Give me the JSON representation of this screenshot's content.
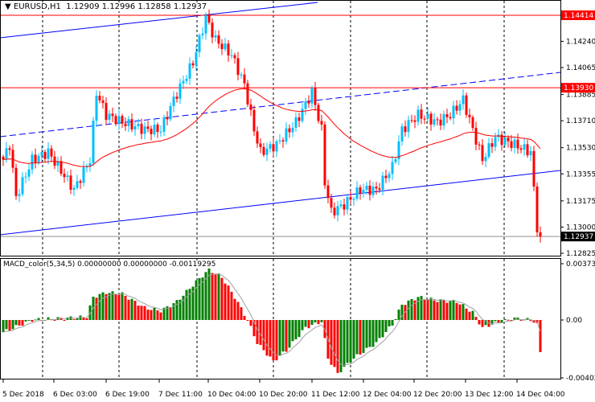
{
  "header": {
    "symbol_label": "EURUSD,H1",
    "ohlc": "1.12909 1.12996 1.12858 1.12937"
  },
  "macd_label": "MACD_color(5,34,5) 0.00000000 0.00000000 -0.00119295",
  "colors": {
    "bull": "#00BFFF",
    "bear": "#FF0000",
    "channel": "#0000FF",
    "level": "#FF0000",
    "ma": "#FF0000",
    "macd_up": "#008000",
    "macd_down": "#FF0000",
    "signal": "#A0A0A0"
  },
  "chart_data": [
    {
      "type": "candlestick",
      "title": "EURUSD,H1",
      "ylim": [
        1.12825,
        1.14414
      ],
      "price_ticks": [
        "1.14240",
        "1.14065",
        "1.13885",
        "1.13710",
        "1.13530",
        "1.13355",
        "1.13175",
        "1.13000",
        "1.12825"
      ],
      "tick_values": [
        1.1424,
        1.14065,
        1.13885,
        1.1371,
        1.1353,
        1.13355,
        1.13175,
        1.13,
        1.12825
      ],
      "levels": [
        {
          "label": "1.14414",
          "value": 1.14414
        },
        {
          "label": "1.13930",
          "value": 1.1393
        }
      ],
      "current_price": {
        "label": "1.12937",
        "value": 1.12937
      },
      "x_labels": [
        "5 Dec 2018",
        "6 Dec 03:00",
        "6 Dec 19:00",
        "7 Dec 11:00",
        "10 Dec 04:00",
        "10 Dec 20:00",
        "11 Dec 12:00",
        "12 Dec 04:00",
        "12 Dec 20:00",
        "13 Dec 12:00",
        "14 Dec 04:00"
      ],
      "close_anchors": [
        [
          0,
          1.1345
        ],
        [
          2,
          1.1355
        ],
        [
          4,
          1.132
        ],
        [
          9,
          1.1345
        ],
        [
          14,
          1.135
        ],
        [
          22,
          1.1325
        ],
        [
          27,
          1.1345
        ],
        [
          29,
          1.139
        ],
        [
          32,
          1.1375
        ],
        [
          37,
          1.137
        ],
        [
          44,
          1.1365
        ],
        [
          49,
          1.1365
        ],
        [
          53,
          1.1385
        ],
        [
          59,
          1.141
        ],
        [
          63,
          1.144
        ],
        [
          66,
          1.1425
        ],
        [
          71,
          1.1415
        ],
        [
          75,
          1.1395
        ],
        [
          78,
          1.1365
        ],
        [
          80,
          1.135
        ],
        [
          85,
          1.1355
        ],
        [
          91,
          1.137
        ],
        [
          96,
          1.139
        ],
        [
          99,
          1.1365
        ],
        [
          100,
          1.133
        ],
        [
          102,
          1.131
        ],
        [
          106,
          1.1315
        ],
        [
          111,
          1.1325
        ],
        [
          116,
          1.1325
        ],
        [
          121,
          1.134
        ],
        [
          124,
          1.1365
        ],
        [
          129,
          1.1375
        ],
        [
          135,
          1.137
        ],
        [
          139,
          1.1375
        ],
        [
          143,
          1.1385
        ],
        [
          146,
          1.1365
        ],
        [
          149,
          1.1345
        ],
        [
          153,
          1.136
        ],
        [
          159,
          1.1355
        ],
        [
          164,
          1.135
        ],
        [
          166,
          1.13
        ],
        [
          167,
          1.12937
        ]
      ]
    },
    {
      "type": "bar",
      "title": "MACD_color(5,34,5)",
      "ylim": [
        -0.004028,
        0.003735
      ],
      "ticks": [
        "0.003735",
        "0.00",
        "-0.004028"
      ],
      "hist_anchors": [
        [
          0,
          -0.0008
        ],
        [
          9,
          0
        ],
        [
          26,
          0.0002
        ],
        [
          28,
          0.0015
        ],
        [
          32,
          0.0018
        ],
        [
          37,
          0.0017
        ],
        [
          44,
          0.0008
        ],
        [
          49,
          0.0006
        ],
        [
          54,
          0.0012
        ],
        [
          60,
          0.0025
        ],
        [
          64,
          0.0033
        ],
        [
          68,
          0.0028
        ],
        [
          72,
          0.0015
        ],
        [
          76,
          0
        ],
        [
          79,
          -0.0015
        ],
        [
          84,
          -0.0027
        ],
        [
          88,
          -0.002
        ],
        [
          94,
          -0.0005
        ],
        [
          99,
          -0.0001
        ],
        [
          101,
          -0.0025
        ],
        [
          104,
          -0.0035
        ],
        [
          109,
          -0.0025
        ],
        [
          116,
          -0.0015
        ],
        [
          121,
          -0.0003
        ],
        [
          124,
          0.001
        ],
        [
          129,
          0.0015
        ],
        [
          134,
          0.0013
        ],
        [
          141,
          0.0012
        ],
        [
          146,
          0.0005
        ],
        [
          149,
          -0.0005
        ],
        [
          153,
          -0.0002
        ],
        [
          159,
          0.0001
        ],
        [
          164,
          0
        ],
        [
          166,
          -0.0002
        ],
        [
          167,
          -0.0021
        ]
      ]
    }
  ]
}
